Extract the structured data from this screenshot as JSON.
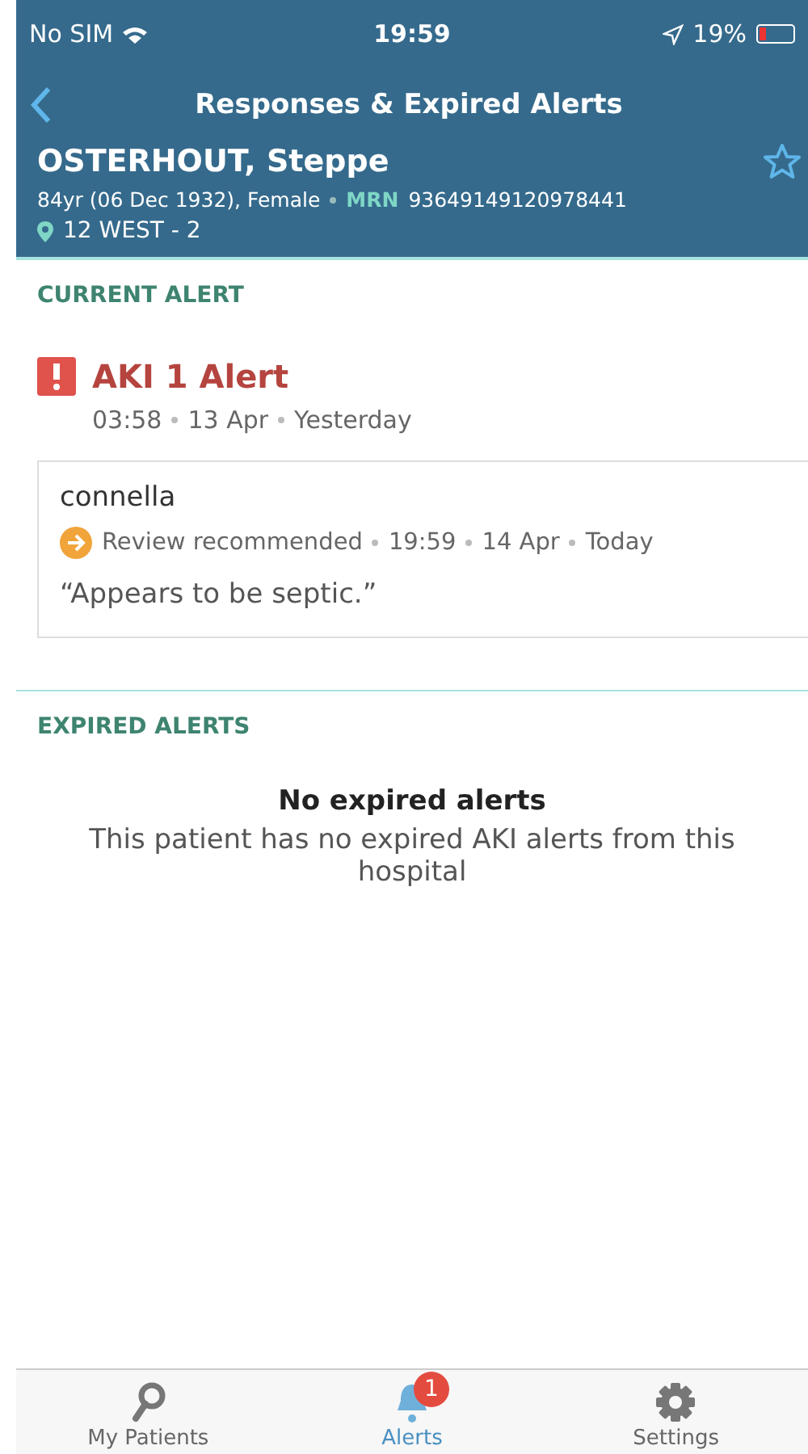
{
  "status_bar": {
    "carrier": "No SIM",
    "time": "19:59",
    "battery": "19%"
  },
  "nav": {
    "title": "Responses & Expired Alerts"
  },
  "patient": {
    "name": "OSTERHOUT, Steppe",
    "details": "84yr (06 Dec 1932), Female",
    "mrn_label": "MRN",
    "mrn": "93649149120978441",
    "location": "12 WEST - 2",
    "favourite": false
  },
  "current": {
    "heading": "CURRENT ALERT",
    "alert": {
      "title": "AKI 1 Alert",
      "meta": [
        "03:58",
        "13 Apr",
        "Yesterday"
      ]
    },
    "responses": [
      {
        "user": "connella",
        "status": "Review recommended",
        "meta": [
          "19:59",
          "14 Apr",
          "Today"
        ],
        "comment": "“Appears to be septic.”"
      }
    ]
  },
  "expired": {
    "heading": "EXPIRED ALERTS",
    "empty_title": "No expired alerts",
    "empty_text": "This patient has no expired AKI alerts from this hospital"
  },
  "tabs": [
    {
      "label": "My Patients",
      "kind": "search",
      "selected": false
    },
    {
      "label": "Alerts",
      "kind": "bell",
      "selected": true,
      "badge": "1"
    },
    {
      "label": "Settings",
      "kind": "gear",
      "selected": false
    }
  ]
}
